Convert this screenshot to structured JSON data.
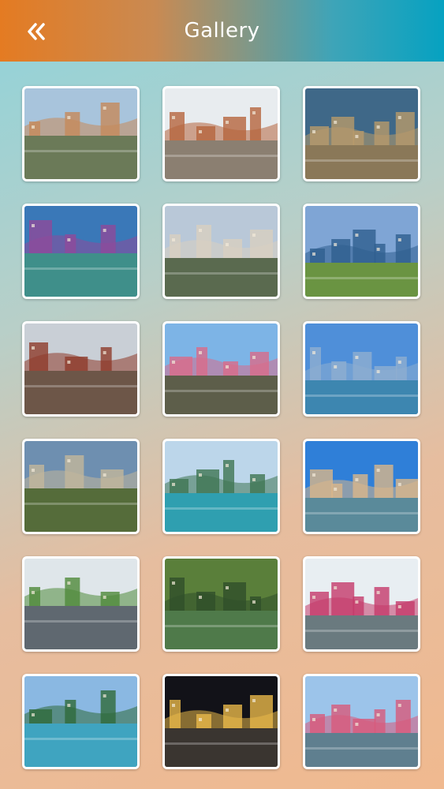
{
  "header": {
    "title": "Gallery",
    "back_icon": "double-chevron-left-icon",
    "gradient": [
      "#e47b22",
      "#06a2c1"
    ]
  },
  "gallery": {
    "items": [
      {
        "name": "photo-canal-village",
        "palette": {
          "sky": "#a8c4dc",
          "ground": "#6b7a58",
          "accent": "#c68a5a"
        }
      },
      {
        "name": "photo-market-street",
        "palette": {
          "sky": "#e8ecef",
          "ground": "#8b7f71",
          "accent": "#b5653d"
        }
      },
      {
        "name": "photo-rooftops-view",
        "palette": {
          "sky": "#3f6888",
          "ground": "#8a7858",
          "accent": "#b89a6a"
        }
      },
      {
        "name": "photo-river-weir",
        "palette": {
          "sky": "#3a78b8",
          "ground": "#3f8f8a",
          "accent": "#8e4a9a"
        }
      },
      {
        "name": "photo-canal-buildings",
        "palette": {
          "sky": "#b9c8d8",
          "ground": "#5a6a4f",
          "accent": "#d8cfc1"
        }
      },
      {
        "name": "photo-lake-panorama",
        "palette": {
          "sky": "#7fa5d5",
          "ground": "#6a9442",
          "accent": "#2f5f8f"
        }
      },
      {
        "name": "photo-chalets-snow",
        "palette": {
          "sky": "#c9cfd6",
          "ground": "#6d5648",
          "accent": "#8e3b2a"
        }
      },
      {
        "name": "photo-old-town-tree",
        "palette": {
          "sky": "#7db4e6",
          "ground": "#5d5e4a",
          "accent": "#d96c8a"
        }
      },
      {
        "name": "photo-lake-mountains",
        "palette": {
          "sky": "#4f8fd9",
          "ground": "#3d86b0",
          "accent": "#8eaed0"
        }
      },
      {
        "name": "photo-castle-hill",
        "palette": {
          "sky": "#6e8fb0",
          "ground": "#556c3a",
          "accent": "#c3b79b"
        }
      },
      {
        "name": "photo-lake-boats",
        "palette": {
          "sky": "#bcd6ea",
          "ground": "#2f9fb0",
          "accent": "#3f7652"
        }
      },
      {
        "name": "photo-church-harbor",
        "palette": {
          "sky": "#2f7fd8",
          "ground": "#5a8a9a",
          "accent": "#d9b78a"
        }
      },
      {
        "name": "photo-tree-avenue",
        "palette": {
          "sky": "#dfe6ea",
          "ground": "#5f6870",
          "accent": "#4f8a3a"
        }
      },
      {
        "name": "photo-green-pond",
        "palette": {
          "sky": "#5a7f3a",
          "ground": "#4f7a4a",
          "accent": "#2f4f2a"
        }
      },
      {
        "name": "photo-flower-canal",
        "palette": {
          "sky": "#e8eef2",
          "ground": "#6a7a7f",
          "accent": "#c43a6a"
        }
      },
      {
        "name": "photo-lake-kayaks",
        "palette": {
          "sky": "#8ab8e2",
          "ground": "#3fa4c0",
          "accent": "#2f6a3a"
        }
      },
      {
        "name": "photo-night-castle",
        "palette": {
          "sky": "#121218",
          "ground": "#3a3530",
          "accent": "#e8b84a"
        }
      },
      {
        "name": "photo-bridge-flowers",
        "palette": {
          "sky": "#9cc4ea",
          "ground": "#5f7f8f",
          "accent": "#d85a7a"
        }
      }
    ]
  }
}
